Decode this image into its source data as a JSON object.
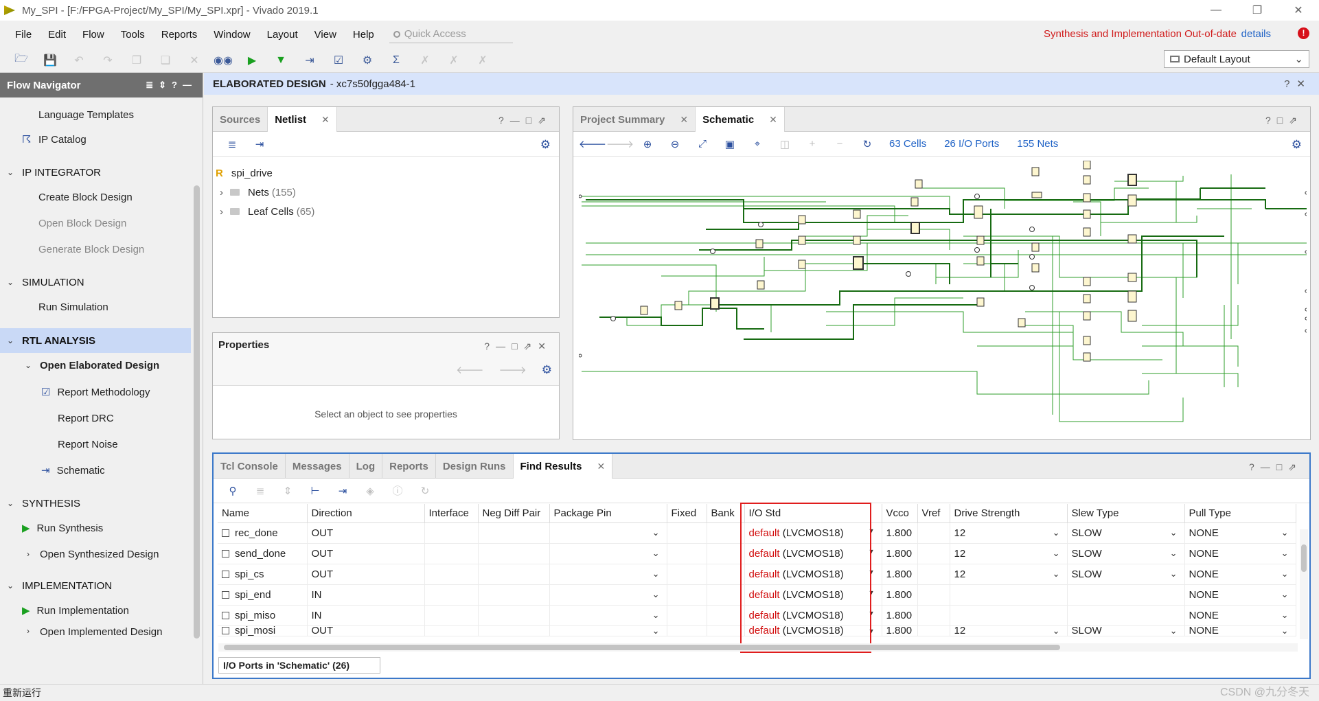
{
  "window": {
    "title": "My_SPI - [F:/FPGA-Project/My_SPI/My_SPI.xpr] - Vivado 2019.1",
    "controls": [
      "—",
      "❐",
      "✕"
    ]
  },
  "menu": [
    "File",
    "Edit",
    "Flow",
    "Tools",
    "Reports",
    "Window",
    "Layout",
    "View",
    "Help"
  ],
  "quick_access": {
    "placeholder": "Quick Access"
  },
  "alert": {
    "message": "Synthesis and Implementation Out-of-date",
    "link": "details",
    "icon": "error-icon"
  },
  "layout_selector": {
    "value": "Default Layout"
  },
  "toolbar_icons": [
    "open-project-icon",
    "save-icon",
    "undo-icon",
    "redo-icon",
    "copy-icon",
    "paste-icon",
    "delete-icon",
    "binoculars-icon",
    "run-icon",
    "step-icon",
    "program-icon",
    "report-icon",
    "settings-icon",
    "sigma-icon",
    "disabled-icon-1",
    "disabled-icon-2",
    "disabled-icon-3"
  ],
  "flow_navigator": {
    "title": "Flow Navigator",
    "items": [
      {
        "label": "Language Templates",
        "kind": "item",
        "icon": "none"
      },
      {
        "label": "IP Catalog",
        "kind": "item",
        "icon": "ip-catalog-icon"
      },
      {
        "label": "IP INTEGRATOR",
        "kind": "section"
      },
      {
        "label": "Create Block Design",
        "kind": "item"
      },
      {
        "label": "Open Block Design",
        "kind": "item",
        "dim": true
      },
      {
        "label": "Generate Block Design",
        "kind": "item",
        "dim": true
      },
      {
        "label": "SIMULATION",
        "kind": "section"
      },
      {
        "label": "Run Simulation",
        "kind": "item"
      },
      {
        "label": "RTL ANALYSIS",
        "kind": "section",
        "selected": true
      },
      {
        "label": "Open Elaborated Design",
        "kind": "subsection"
      },
      {
        "label": "Report Methodology",
        "kind": "subitem",
        "icon": "clipboard-icon"
      },
      {
        "label": "Report DRC",
        "kind": "subitem"
      },
      {
        "label": "Report Noise",
        "kind": "subitem"
      },
      {
        "label": "Schematic",
        "kind": "subitem",
        "icon": "schematic-icon"
      },
      {
        "label": "SYNTHESIS",
        "kind": "section"
      },
      {
        "label": "Run Synthesis",
        "kind": "item",
        "icon": "run-icon"
      },
      {
        "label": "Open Synthesized Design",
        "kind": "item-collapsed"
      },
      {
        "label": "IMPLEMENTATION",
        "kind": "section"
      },
      {
        "label": "Run Implementation",
        "kind": "item",
        "icon": "run-icon"
      },
      {
        "label": "Open Implemented Design",
        "kind": "item-collapsed"
      }
    ]
  },
  "design_header": {
    "title": "ELABORATED DESIGN",
    "part": "- xc7s50fgga484-1"
  },
  "sources_panel": {
    "tabs": [
      "Sources",
      "Netlist"
    ],
    "active_tab": "Netlist",
    "tree": {
      "root": {
        "label": "spi_drive",
        "badge": "R"
      },
      "children": [
        {
          "label": "Nets",
          "count": "(155)"
        },
        {
          "label": "Leaf Cells",
          "count": "(65)"
        }
      ]
    }
  },
  "properties_panel": {
    "title": "Properties",
    "empty_text": "Select an object to see properties"
  },
  "schematic_panel": {
    "tabs": [
      "Project Summary",
      "Schematic"
    ],
    "active_tab": "Schematic",
    "stats": {
      "cells": "63 Cells",
      "ports": "26 I/O Ports",
      "nets": "155 Nets"
    }
  },
  "bottom_panel": {
    "tabs": [
      "Tcl Console",
      "Messages",
      "Log",
      "Reports",
      "Design Runs",
      "Find Results"
    ],
    "active_tab": "Find Results",
    "columns": [
      "Name",
      "Direction",
      "Interface",
      "Neg Diff Pair",
      "Package Pin",
      "Fixed",
      "Bank",
      "I/O Std",
      "Vcco",
      "Vref",
      "Drive Strength",
      "Slew Type",
      "Pull Type"
    ],
    "rows": [
      {
        "name": "rec_done",
        "direction": "OUT",
        "iostd_default": "default",
        "iostd_val": "(LVCMOS18)",
        "vcco": "1.800",
        "drive": "12",
        "slew": "SLOW",
        "pull": "NONE"
      },
      {
        "name": "send_done",
        "direction": "OUT",
        "iostd_default": "default",
        "iostd_val": "(LVCMOS18)",
        "vcco": "1.800",
        "drive": "12",
        "slew": "SLOW",
        "pull": "NONE"
      },
      {
        "name": "spi_cs",
        "direction": "OUT",
        "iostd_default": "default",
        "iostd_val": "(LVCMOS18)",
        "vcco": "1.800",
        "drive": "12",
        "slew": "SLOW",
        "pull": "NONE"
      },
      {
        "name": "spi_end",
        "direction": "IN",
        "iostd_default": "default",
        "iostd_val": "(LVCMOS18)",
        "vcco": "1.800",
        "drive": "",
        "slew": "",
        "pull": "NONE"
      },
      {
        "name": "spi_miso",
        "direction": "IN",
        "iostd_default": "default",
        "iostd_val": "(LVCMOS18)",
        "vcco": "1.800",
        "drive": "",
        "slew": "",
        "pull": "NONE"
      },
      {
        "name": "spi_mosi",
        "direction": "OUT",
        "iostd_default": "default",
        "iostd_val": "(LVCMOS18)",
        "vcco": "1.800",
        "drive": "12",
        "slew": "SLOW",
        "pull": "NONE"
      }
    ],
    "footer_tab": "I/O Ports in 'Schematic' (26)"
  },
  "statusbar": {
    "text": "重新运行"
  },
  "watermark": "CSDN @九分冬天"
}
